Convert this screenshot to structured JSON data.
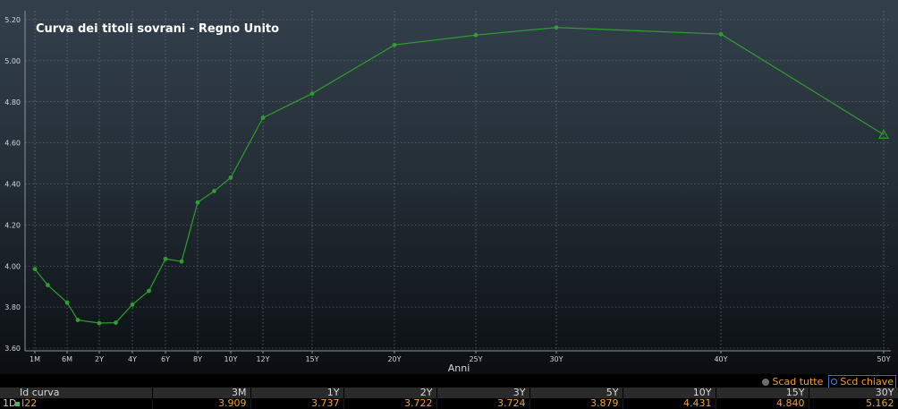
{
  "chart_data": {
    "type": "line",
    "title": "Curva dei titoli sovrani - Regno Unito",
    "xlabel": "Anni",
    "ylabel": "",
    "ylim": [
      3.6,
      5.2
    ],
    "yticks": [
      "3.60",
      "3.80",
      "4.00",
      "4.20",
      "4.40",
      "4.60",
      "4.80",
      "5.00",
      "5.20"
    ],
    "x_tick_labels": [
      "1M",
      "6M",
      "2Y",
      "4Y",
      "6Y",
      "8Y",
      "10Y",
      "12Y",
      "15Y",
      "20Y",
      "25Y",
      "30Y",
      "40Y",
      "50Y"
    ],
    "grid": true,
    "series": [
      {
        "color": "#2e9e2e",
        "points": [
          {
            "x": 0.083,
            "y": 3.985
          },
          {
            "x": 0.25,
            "y": 3.907
          },
          {
            "x": 0.5,
            "y": 3.822
          },
          {
            "x": 1,
            "y": 3.737
          },
          {
            "x": 2,
            "y": 3.722
          },
          {
            "x": 3,
            "y": 3.724
          },
          {
            "x": 4,
            "y": 3.812
          },
          {
            "x": 5,
            "y": 3.879
          },
          {
            "x": 6,
            "y": 4.035
          },
          {
            "x": 7,
            "y": 4.022
          },
          {
            "x": 8,
            "y": 4.31
          },
          {
            "x": 9,
            "y": 4.365
          },
          {
            "x": 10,
            "y": 4.431
          },
          {
            "x": 12,
            "y": 4.722
          },
          {
            "x": 15,
            "y": 4.84
          },
          {
            "x": 20,
            "y": 5.077
          },
          {
            "x": 25,
            "y": 5.125
          },
          {
            "x": 30,
            "y": 5.162
          },
          {
            "x": 40,
            "y": 5.13
          },
          {
            "x": 50,
            "y": 4.64
          }
        ]
      }
    ]
  },
  "legend": {
    "all_label": "Scad tutte",
    "key_label": "Scd chiave"
  },
  "table": {
    "header": [
      "Id curva",
      "3M",
      "1Y",
      "2Y",
      "3Y",
      "5Y",
      "10Y",
      "15Y",
      "30Y"
    ],
    "rows": [
      {
        "index": "1D",
        "id": "I22",
        "values": [
          "3.909",
          "3.737",
          "3.722",
          "3.724",
          "3.879",
          "4.431",
          "4.840",
          "5.162"
        ]
      }
    ]
  },
  "colors": {
    "line": "#2e9e2e",
    "text_value": "#f0a030",
    "background_top": "#33404c",
    "background_bottom": "#0b0e11"
  }
}
